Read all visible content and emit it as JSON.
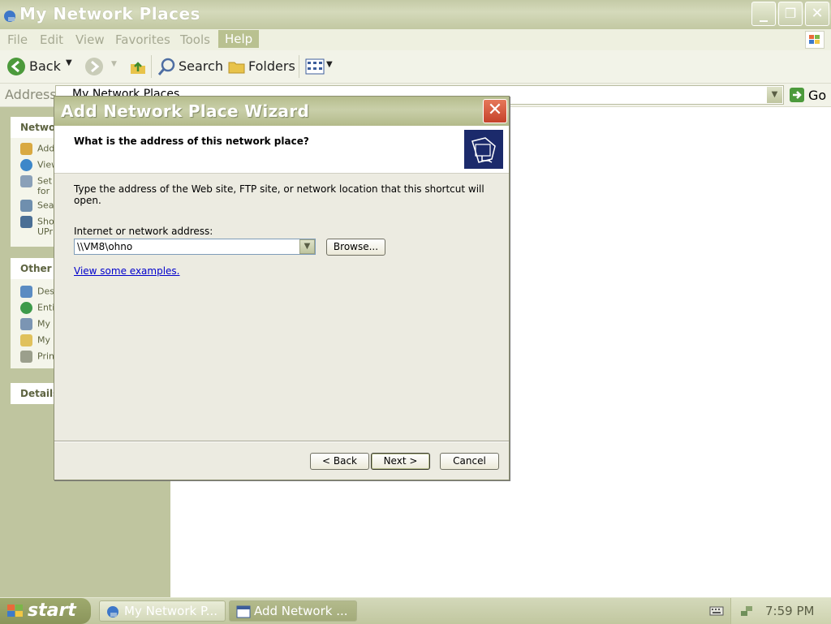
{
  "window": {
    "title": "My Network Places",
    "controls": {
      "minimize": "_",
      "maximize": "❐",
      "close": "✕"
    }
  },
  "menu": [
    "File",
    "Edit",
    "View",
    "Favorites",
    "Tools",
    "Help"
  ],
  "toolbar": {
    "back": "Back",
    "search": "Search",
    "folders": "Folders"
  },
  "address": {
    "label": "Address",
    "value": "My Network Places",
    "go": "Go"
  },
  "left_pane": {
    "network_tasks": {
      "header": "Networ",
      "items": [
        "Add",
        "View",
        "Set",
        "for",
        "Sea",
        "Sho",
        "UPr"
      ]
    },
    "other_places": {
      "header": "Other P",
      "items": [
        "Des",
        "Enti",
        "My",
        "My",
        "Prin"
      ]
    },
    "details": {
      "header": "Details"
    }
  },
  "dialog": {
    "title": "Add Network Place Wizard",
    "question": "What is the address of this network place?",
    "instruction": "Type the address of the Web site, FTP site, or network location that this shortcut will open.",
    "address_label": "Internet or network address:",
    "address_value": "\\\\VM8\\ohno",
    "browse": "Browse...",
    "examples_link": "View some examples.",
    "back": "< Back",
    "next": "Next >",
    "cancel": "Cancel"
  },
  "taskbar": {
    "start": "start",
    "tasks": [
      "My Network P...",
      "Add Network ..."
    ],
    "clock": "7:59 PM"
  },
  "colors": {
    "title_bar": "#c4caa6",
    "dialog_bg": "#ecebe1",
    "link": "#0000cc",
    "left_pane": "#bfc59f"
  }
}
